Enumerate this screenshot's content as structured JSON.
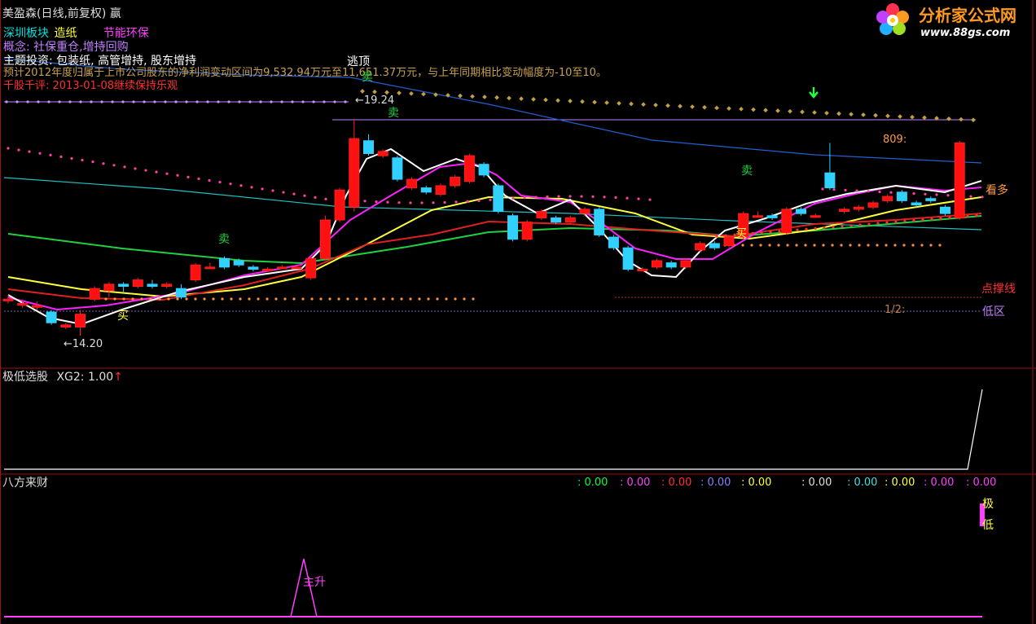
{
  "header": {
    "title": "美盈森(日线,前复权) 赢",
    "sectors": [
      {
        "text": "深圳板块",
        "color": "#00e0e0"
      },
      {
        "text": "造纸",
        "color": "#ffff40"
      },
      {
        "text": "节能环保",
        "color": "#ff40ff"
      }
    ],
    "concept": "概念: 社保重仓,增持回购",
    "theme": "主题投资: 包装纸, 高管增持, 股东增持",
    "forecast": "预计2012年度归属于上市公司股东的净利润变动区间为9,532.94万元至11,651.37万元，与上年同期相比变动幅度为-10至10。",
    "review": "千股千评: 2013-01-08继续保持乐观"
  },
  "logo": {
    "text": "分析家公式网",
    "url": "www.88gs.com"
  },
  "main_labels": {
    "escape_top": "逃顶",
    "sell": "卖",
    "buy": "买",
    "high_price": "←19.24",
    "low_price": "←14.20",
    "support_value": "809:",
    "look_long": "看多",
    "support_line": "点撑线",
    "low_zone": "低区",
    "half": "1/2:"
  },
  "panel2": {
    "title": "极低选股",
    "indicator": "XG2: 1.00",
    "arrow": "↑"
  },
  "panel3": {
    "title": "八方来财",
    "values": [
      {
        "text": ": 0.00",
        "color": "#00ff40"
      },
      {
        "text": ": 0.00",
        "color": "#ff40ff"
      },
      {
        "text": ": 0.00",
        "color": "#ff3030"
      },
      {
        "text": ": 0.00",
        "color": "#8080ff"
      },
      {
        "text": ": 0.00",
        "color": "#ffff40"
      },
      {
        "text": ": 0.00",
        "color": "#e0e0e0"
      },
      {
        "text": ": 0.00",
        "color": "#40e0e0"
      },
      {
        "text": ": 0.00",
        "color": "#ffff40"
      },
      {
        "text": ": 0.00",
        "color": "#ff40ff"
      },
      {
        "text": ": 0.00",
        "color": "#ff40ff"
      }
    ],
    "main_rise": "主升",
    "extreme_low_1": "极",
    "extreme_low_2": "低"
  },
  "chart_data": {
    "type": "candlestick",
    "price_range": [
      14.2,
      19.24
    ],
    "candles": [
      {
        "o": 15.05,
        "c": 15.05,
        "h": 15.15,
        "l": 14.95,
        "up": true
      },
      {
        "o": 14.95,
        "c": 14.95,
        "h": 15.05,
        "l": 14.85,
        "up": true
      },
      {
        "o": 14.9,
        "c": 14.9,
        "h": 15.0,
        "l": 14.8,
        "up": true
      },
      {
        "o": 14.75,
        "c": 14.5,
        "h": 14.8,
        "l": 14.45,
        "up": false
      },
      {
        "o": 14.45,
        "c": 14.4,
        "h": 14.5,
        "l": 14.35,
        "up": true
      },
      {
        "o": 14.4,
        "c": 14.7,
        "h": 14.8,
        "l": 14.2,
        "up": true
      },
      {
        "o": 15.05,
        "c": 15.3,
        "h": 15.35,
        "l": 15.0,
        "up": true
      },
      {
        "o": 15.25,
        "c": 15.4,
        "h": 15.45,
        "l": 15.1,
        "up": true
      },
      {
        "o": 15.4,
        "c": 15.35,
        "h": 15.45,
        "l": 15.2,
        "up": false
      },
      {
        "o": 15.35,
        "c": 15.5,
        "h": 15.55,
        "l": 15.3,
        "up": true
      },
      {
        "o": 15.4,
        "c": 15.35,
        "h": 15.5,
        "l": 15.3,
        "up": false
      },
      {
        "o": 15.35,
        "c": 15.4,
        "h": 15.45,
        "l": 15.3,
        "up": true
      },
      {
        "o": 15.3,
        "c": 15.1,
        "h": 15.4,
        "l": 15.05,
        "up": false
      },
      {
        "o": 15.5,
        "c": 15.85,
        "h": 15.9,
        "l": 15.45,
        "up": true
      },
      {
        "o": 15.8,
        "c": 15.8,
        "h": 15.9,
        "l": 15.75,
        "up": true
      },
      {
        "o": 16.0,
        "c": 15.8,
        "h": 16.05,
        "l": 15.75,
        "up": false
      },
      {
        "o": 15.95,
        "c": 15.85,
        "h": 16.0,
        "l": 15.8,
        "up": false
      },
      {
        "o": 15.8,
        "c": 15.75,
        "h": 15.85,
        "l": 15.7,
        "up": false
      },
      {
        "o": 15.75,
        "c": 15.75,
        "h": 15.8,
        "l": 15.7,
        "up": true
      },
      {
        "o": 15.8,
        "c": 15.8,
        "h": 15.85,
        "l": 15.75,
        "up": true
      },
      {
        "o": 15.8,
        "c": 15.8,
        "h": 15.85,
        "l": 15.75,
        "up": true
      },
      {
        "o": 15.55,
        "c": 16.0,
        "h": 16.05,
        "l": 15.5,
        "up": true
      },
      {
        "o": 16.0,
        "c": 16.9,
        "h": 17.0,
        "l": 15.95,
        "up": true
      },
      {
        "o": 16.9,
        "c": 17.6,
        "h": 17.65,
        "l": 16.85,
        "up": true
      },
      {
        "o": 17.2,
        "c": 18.8,
        "h": 19.24,
        "l": 17.1,
        "up": true
      },
      {
        "o": 18.75,
        "c": 18.45,
        "h": 18.9,
        "l": 18.4,
        "up": false
      },
      {
        "o": 18.4,
        "c": 18.5,
        "h": 18.55,
        "l": 18.35,
        "up": true
      },
      {
        "o": 18.35,
        "c": 17.85,
        "h": 18.4,
        "l": 17.8,
        "up": false
      },
      {
        "o": 17.85,
        "c": 17.65,
        "h": 17.9,
        "l": 17.6,
        "up": true
      },
      {
        "o": 17.65,
        "c": 17.55,
        "h": 17.7,
        "l": 17.5,
        "up": false
      },
      {
        "o": 17.5,
        "c": 17.7,
        "h": 17.75,
        "l": 17.45,
        "up": true
      },
      {
        "o": 17.7,
        "c": 17.9,
        "h": 17.95,
        "l": 17.65,
        "up": true
      },
      {
        "o": 17.8,
        "c": 18.4,
        "h": 18.45,
        "l": 17.75,
        "up": true
      },
      {
        "o": 18.2,
        "c": 17.95,
        "h": 18.25,
        "l": 17.9,
        "up": false
      },
      {
        "o": 17.7,
        "c": 17.1,
        "h": 17.75,
        "l": 17.05,
        "up": false
      },
      {
        "o": 17.0,
        "c": 16.45,
        "h": 17.05,
        "l": 16.4,
        "up": false
      },
      {
        "o": 16.45,
        "c": 16.85,
        "h": 16.9,
        "l": 16.4,
        "up": true
      },
      {
        "o": 16.95,
        "c": 17.1,
        "h": 17.15,
        "l": 16.9,
        "up": true
      },
      {
        "o": 16.95,
        "c": 16.85,
        "h": 17.0,
        "l": 16.8,
        "up": false
      },
      {
        "o": 16.85,
        "c": 16.95,
        "h": 17.0,
        "l": 16.8,
        "up": true
      },
      {
        "o": 17.05,
        "c": 17.15,
        "h": 17.2,
        "l": 17.0,
        "up": true
      },
      {
        "o": 17.15,
        "c": 16.55,
        "h": 17.2,
        "l": 16.5,
        "up": false
      },
      {
        "o": 16.5,
        "c": 16.25,
        "h": 16.55,
        "l": 16.2,
        "up": false
      },
      {
        "o": 16.25,
        "c": 15.75,
        "h": 16.3,
        "l": 15.7,
        "up": false
      },
      {
        "o": 15.75,
        "c": 15.75,
        "h": 15.8,
        "l": 15.7,
        "up": true
      },
      {
        "o": 15.8,
        "c": 15.95,
        "h": 16.0,
        "l": 15.75,
        "up": true
      },
      {
        "o": 15.9,
        "c": 15.8,
        "h": 15.95,
        "l": 15.75,
        "up": false
      },
      {
        "o": 15.8,
        "c": 15.95,
        "h": 16.0,
        "l": 15.75,
        "up": true
      },
      {
        "o": 16.2,
        "c": 16.35,
        "h": 16.4,
        "l": 16.15,
        "up": true
      },
      {
        "o": 16.35,
        "c": 16.25,
        "h": 16.4,
        "l": 16.2,
        "up": false
      },
      {
        "o": 16.3,
        "c": 16.5,
        "h": 16.55,
        "l": 16.25,
        "up": true
      },
      {
        "o": 16.5,
        "c": 17.05,
        "h": 17.1,
        "l": 16.45,
        "up": true
      },
      {
        "o": 17.0,
        "c": 17.0,
        "h": 17.1,
        "l": 16.95,
        "up": true
      },
      {
        "o": 17.0,
        "c": 16.95,
        "h": 17.05,
        "l": 16.9,
        "up": false
      },
      {
        "o": 16.6,
        "c": 17.15,
        "h": 17.2,
        "l": 16.55,
        "up": true
      },
      {
        "o": 17.15,
        "c": 17.05,
        "h": 17.2,
        "l": 17.0,
        "up": false
      },
      {
        "o": 17.0,
        "c": 17.0,
        "h": 17.05,
        "l": 16.95,
        "up": true
      },
      {
        "o": 17.65,
        "c": 18.0,
        "h": 18.7,
        "l": 17.6,
        "up": false
      },
      {
        "o": 17.1,
        "c": 17.15,
        "h": 17.2,
        "l": 17.05,
        "up": true
      },
      {
        "o": 17.15,
        "c": 17.2,
        "h": 17.25,
        "l": 17.1,
        "up": true
      },
      {
        "o": 17.2,
        "c": 17.3,
        "h": 17.35,
        "l": 17.15,
        "up": true
      },
      {
        "o": 17.35,
        "c": 17.45,
        "h": 17.5,
        "l": 17.3,
        "up": true
      },
      {
        "o": 17.55,
        "c": 17.35,
        "h": 17.6,
        "l": 17.3,
        "up": false
      },
      {
        "o": 17.3,
        "c": 17.25,
        "h": 17.35,
        "l": 17.2,
        "up": false
      },
      {
        "o": 17.4,
        "c": 17.35,
        "h": 17.45,
        "l": 17.3,
        "up": false
      },
      {
        "o": 17.2,
        "c": 17.05,
        "h": 17.25,
        "l": 17.0,
        "up": false
      },
      {
        "o": 16.95,
        "c": 18.7,
        "h": 18.75,
        "l": 16.9,
        "up": true
      }
    ]
  }
}
